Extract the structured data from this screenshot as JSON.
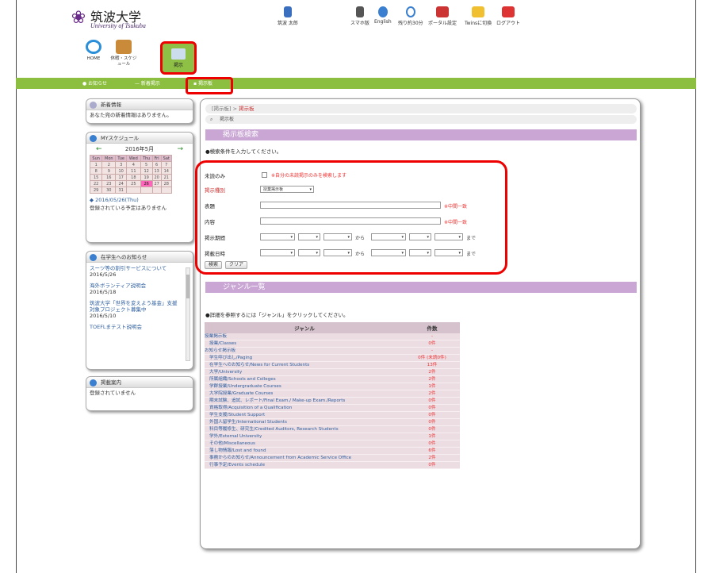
{
  "header": {
    "univ_jp": "筑波大学",
    "univ_en": "University of Tsukuba",
    "user": "筑波 太郎",
    "links": [
      "スマホ版",
      "English",
      "残り約30分",
      "ポータル設定",
      "Twinsに切換",
      "ログアウト"
    ]
  },
  "nav": {
    "home": "HOME",
    "schedule": "休暇・スケジュール",
    "board": "掲示"
  },
  "greenbar": {
    "items": [
      "お知らせ",
      "新着掲示",
      "掲示板"
    ]
  },
  "sidebar": {
    "new_info": {
      "title": "新着情報",
      "text": "あなた宛の新着情報はありません。"
    },
    "schedule": {
      "title": "MYスケジュール",
      "month": "2016年5月",
      "days": [
        "Sun",
        "Mon",
        "Tue",
        "Wed",
        "Thu",
        "Fri",
        "Sat"
      ],
      "weeks": [
        [
          "1",
          "2",
          "3",
          "4",
          "5",
          "6",
          "7"
        ],
        [
          "8",
          "9",
          "10",
          "11",
          "12",
          "13",
          "14"
        ],
        [
          "15",
          "16",
          "17",
          "18",
          "19",
          "20",
          "21"
        ],
        [
          "22",
          "23",
          "24",
          "25",
          "26",
          "27",
          "28"
        ],
        [
          "29",
          "30",
          "31",
          "",
          "",
          "",
          ""
        ]
      ],
      "today": "26",
      "date_link": "2016/05/26(Thu)",
      "text": "登録されている予定はありません"
    },
    "notice": {
      "title": "在学生へのお知らせ",
      "items": [
        {
          "title": "スーツ等の割引サービスについて",
          "date": "2016/5/26"
        },
        {
          "title": "海外ボランティア説明会",
          "date": "2016/5/18"
        },
        {
          "title": "筑波大学「世界を変えよう基金」支援対象プロジェクト募集中",
          "date": "2016/5/10"
        },
        {
          "title": "TOEFLまテスト説明会",
          "date": ""
        }
      ]
    },
    "posting": {
      "title": "掲載案内",
      "text": "登録されていません"
    }
  },
  "main": {
    "crumb_prefix": "[掲示板] > ",
    "crumb_current": "掲示板",
    "search_title": "掲示板",
    "search_section": "掲示板検索",
    "search_instr": "●検索条件を入力してください。",
    "form": {
      "unread_label": "未読のみ",
      "unread_note": "※自分の未読掲示のみを検索します",
      "type_label": "掲示種別",
      "type_value": "授業掲示板",
      "title_label": "表題",
      "content_label": "内容",
      "match_note": "※中間一致",
      "period_label": "掲示期間",
      "date_label": "掲載日時",
      "kara": "から",
      "made": "まで",
      "search_btn": "検索",
      "clear_btn": "クリア"
    },
    "genre_section": "ジャンル一覧",
    "genre_instr": "●詳細を参照するには「ジャンル」をクリックしてください。",
    "table": {
      "col_genre": "ジャンル",
      "col_count": "件数",
      "rows": [
        [
          "授業掲示板",
          "-",
          0
        ],
        [
          "授業/Classes",
          "0件",
          1
        ],
        [
          "お知らせ掲示板",
          "-",
          0
        ],
        [
          "学生呼び出し/Paging",
          "0件 (未読0件)",
          1
        ],
        [
          "在学生へのお知らせ/News for Current Students",
          "13件",
          1
        ],
        [
          "大学/University",
          "2件",
          1
        ],
        [
          "所属組織/Schools and Colleges",
          "2件",
          1
        ],
        [
          "学群授業/Undergraduate Courses",
          "1件",
          1
        ],
        [
          "大学院授業/Graduate Courses",
          "2件",
          1
        ],
        [
          "期末試験、追試、レポート/Final Exam./ Make-up Exam./Reports",
          "0件",
          1
        ],
        [
          "資格取得/Acquisition of a Qualification",
          "0件",
          1
        ],
        [
          "学生支援/Student Support",
          "0件",
          1
        ],
        [
          "外国人留学生/International Students",
          "0件",
          1
        ],
        [
          "科目等履修生、研究生/Credited Auditors, Research Students",
          "0件",
          1
        ],
        [
          "学外/External University",
          "1件",
          1
        ],
        [
          "その他/Miscellaneous",
          "0件",
          1
        ],
        [
          "落し物情報/Lost and found",
          "6件",
          1
        ],
        [
          "事務からのお知らせ/Announcement from Academic Service Office",
          "2件",
          1
        ],
        [
          "行事予定/Events schedule",
          "0件",
          1
        ]
      ]
    }
  }
}
